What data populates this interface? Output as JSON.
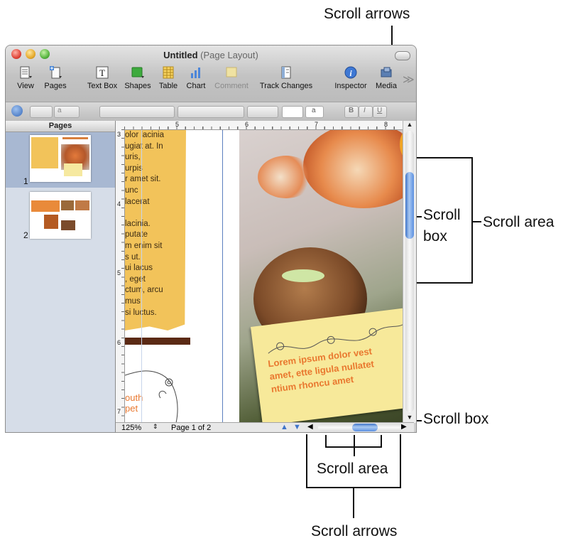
{
  "annotations": {
    "top_scroll_arrows": "Scroll arrows",
    "scroll_box_vertical": "Scroll box",
    "scroll_area_vertical": "Scroll area",
    "scroll_box_horizontal": "Scroll box",
    "scroll_area_horizontal": "Scroll area",
    "bottom_scroll_arrows": "Scroll arrows"
  },
  "window": {
    "title": "Untitled",
    "title_suffix": "(Page Layout)"
  },
  "toolbar": {
    "items": [
      {
        "label": "View",
        "icon": "view-icon"
      },
      {
        "label": "Pages",
        "icon": "pages-icon"
      },
      {
        "label": "Text Box",
        "icon": "text-box-icon"
      },
      {
        "label": "Shapes",
        "icon": "shapes-icon"
      },
      {
        "label": "Table",
        "icon": "table-icon"
      },
      {
        "label": "Chart",
        "icon": "chart-icon"
      },
      {
        "label": "Comment",
        "icon": "comment-icon",
        "disabled": true
      },
      {
        "label": "Track Changes",
        "icon": "track-changes-icon"
      },
      {
        "label": "Inspector",
        "icon": "inspector-icon"
      },
      {
        "label": "Media",
        "icon": "media-icon"
      }
    ],
    "overflow_glyph": "≫"
  },
  "format_bar": {
    "style_a": "a",
    "bold": "B",
    "italic": "I",
    "underline": "U"
  },
  "sidebar": {
    "header": "Pages",
    "pages": [
      {
        "number": "1",
        "selected": true
      },
      {
        "number": "2",
        "selected": false
      }
    ]
  },
  "ruler": {
    "horizontal": [
      "5",
      "6",
      "7",
      "8"
    ],
    "vertical": [
      "3",
      "4",
      "5",
      "6",
      "7"
    ]
  },
  "document": {
    "text_lines": [
      "olor lacinia",
      "ugiat at. In",
      "uris,",
      "urpis",
      "r amet sit.",
      "unc",
      "lacerat",
      "",
      "lacinia.",
      "putate",
      "m enim sit",
      "s ut.",
      "ui lacus",
      ", eget",
      "ctum, arcu",
      "mus",
      "si luctus."
    ],
    "orange_text": [
      "outh",
      "pet"
    ],
    "card_text": [
      "Lorem ipsum dolor vest",
      "amet, ette ligula nullatet",
      "ntium rhoncu amet"
    ]
  },
  "status": {
    "zoom": "125%",
    "page_indicator": "Page 1 of 2"
  },
  "colors": {
    "accent_blue": "#5b86d6",
    "highlight_orange": "#f2c35a",
    "card_yellow": "#f7e99a",
    "card_text": "#e9782f"
  }
}
